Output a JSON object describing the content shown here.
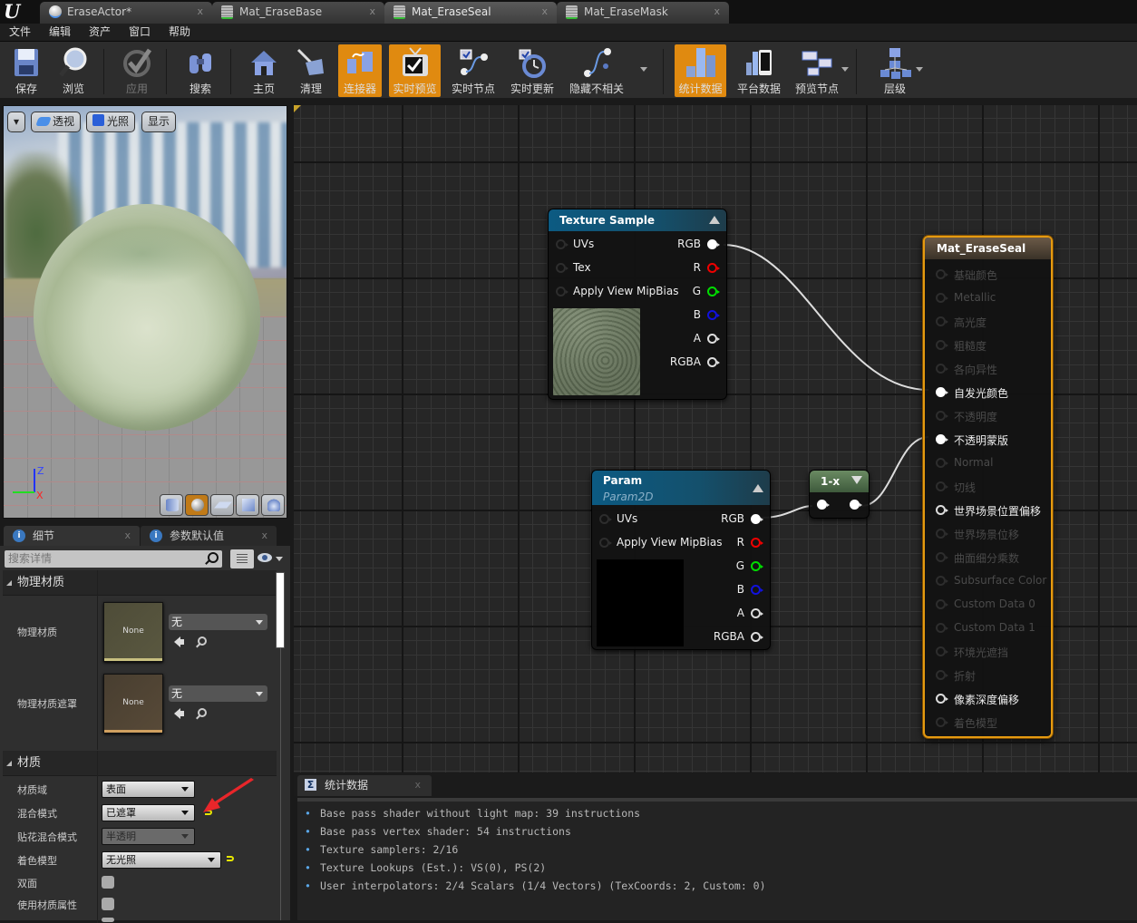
{
  "window": {
    "logo": "U",
    "tabs": [
      {
        "label": "EraseActor*",
        "icon": "sphere-actor-icon",
        "active": false
      },
      {
        "label": "Mat_EraseBase",
        "icon": "material-icon",
        "active": false
      },
      {
        "label": "Mat_EraseSeal",
        "icon": "material-icon",
        "active": true
      },
      {
        "label": "Mat_EraseMask",
        "icon": "material-icon",
        "active": false
      }
    ],
    "tab_close": "x"
  },
  "menu": [
    "文件",
    "编辑",
    "资产",
    "窗口",
    "帮助"
  ],
  "toolbar": {
    "save": "保存",
    "browse": "浏览",
    "apply": "应用",
    "search": "搜索",
    "home": "主页",
    "clean": "清理",
    "connectors": "连接器",
    "live_preview": "实时预览",
    "live_nodes": "实时节点",
    "live_update": "实时更新",
    "hide_unrelated": "隐藏不相关",
    "stats": "统计数据",
    "platform_stats": "平台数据",
    "preview_nodes": "预览节点",
    "hierarchy": "层级"
  },
  "viewport": {
    "menu_button": "▾",
    "perspective": "透视",
    "lit": "光照",
    "show": "显示",
    "axis": {
      "z": "Z",
      "x": "X"
    },
    "preview_shapes": [
      "cylinder",
      "sphere",
      "plane",
      "cube",
      "custom-mesh"
    ],
    "active_shape": "sphere"
  },
  "details": {
    "tabs": [
      {
        "label": "细节",
        "active": true
      },
      {
        "label": "参数默认值",
        "active": false
      }
    ],
    "search_placeholder": "搜索详情",
    "categories": {
      "physical_material": {
        "title": "物理材质",
        "rows": [
          {
            "label": "物理材质",
            "thumb": "None",
            "value": "无"
          },
          {
            "label": "物理材质遮罩",
            "thumb": "None",
            "value": "无"
          }
        ]
      },
      "material": {
        "title": "材质",
        "rows": [
          {
            "label": "材质域",
            "value": "表面"
          },
          {
            "label": "混合模式",
            "value": "已遮罩",
            "reset": true
          },
          {
            "label": "贴花混合模式",
            "value": "半透明",
            "disabled": true
          },
          {
            "label": "着色模型",
            "value": "无光照",
            "reset": true
          },
          {
            "label": "双面",
            "checked": false
          },
          {
            "label": "使用材质属性",
            "checked": false
          }
        ]
      }
    }
  },
  "graph": {
    "texture_sample": {
      "title": "Texture Sample",
      "inputs": [
        "UVs",
        "Tex",
        "Apply View MipBias"
      ],
      "outputs": [
        "RGB",
        "R",
        "G",
        "B",
        "A",
        "RGBA"
      ]
    },
    "param": {
      "title": "Param",
      "subtitle": "Param2D",
      "inputs": [
        "UVs",
        "Apply View MipBias"
      ],
      "outputs": [
        "RGB",
        "R",
        "G",
        "B",
        "A",
        "RGBA"
      ]
    },
    "one_minus": {
      "title": "1-x"
    },
    "result": {
      "title": "Mat_EraseSeal",
      "pins": [
        {
          "label": "基础颜色",
          "state": "dim"
        },
        {
          "label": "Metallic",
          "state": "dim"
        },
        {
          "label": "高光度",
          "state": "dim"
        },
        {
          "label": "粗糙度",
          "state": "dim"
        },
        {
          "label": "各向异性",
          "state": "dim"
        },
        {
          "label": "自发光颜色",
          "state": "connected"
        },
        {
          "label": "不透明度",
          "state": "dim"
        },
        {
          "label": "不透明蒙版",
          "state": "connected"
        },
        {
          "label": "Normal",
          "state": "dim"
        },
        {
          "label": "切线",
          "state": "dim"
        },
        {
          "label": "世界场景位置偏移",
          "state": "active"
        },
        {
          "label": "世界场景位移",
          "state": "dim"
        },
        {
          "label": "曲面细分乘数",
          "state": "dim"
        },
        {
          "label": "Subsurface Color",
          "state": "dim"
        },
        {
          "label": "Custom Data 0",
          "state": "dim"
        },
        {
          "label": "Custom Data 1",
          "state": "dim"
        },
        {
          "label": "环境光遮挡",
          "state": "dim"
        },
        {
          "label": "折射",
          "state": "dim"
        },
        {
          "label": "像素深度偏移",
          "state": "active"
        },
        {
          "label": "着色模型",
          "state": "dim"
        }
      ]
    },
    "connections": [
      {
        "from": "Texture Sample.RGB",
        "to": "Mat_EraseSeal.自发光颜色"
      },
      {
        "from": "Param.RGB",
        "to": "1-x.input"
      },
      {
        "from": "1-x.output",
        "to": "Mat_EraseSeal.不透明蒙版"
      }
    ]
  },
  "stats": {
    "tab_label": "统计数据",
    "lines": [
      "Base pass shader without light map: 39 instructions",
      "Base pass vertex shader: 54 instructions",
      "Texture samplers: 2/16",
      "Texture Lookups (Est.): VS(0), PS(2)",
      "User interpolators: 2/4 Scalars (1/4 Vectors) (TexCoords: 2, Custom: 0)"
    ]
  },
  "colors": {
    "accent_orange": "#e08a10",
    "result_border": "#e59a10",
    "pin_red": "#e00000",
    "pin_green": "#00dd00",
    "pin_blue": "#1111dd",
    "stat_bullet": "#5aa7e8",
    "annotation_arrow": "#e8262a"
  }
}
